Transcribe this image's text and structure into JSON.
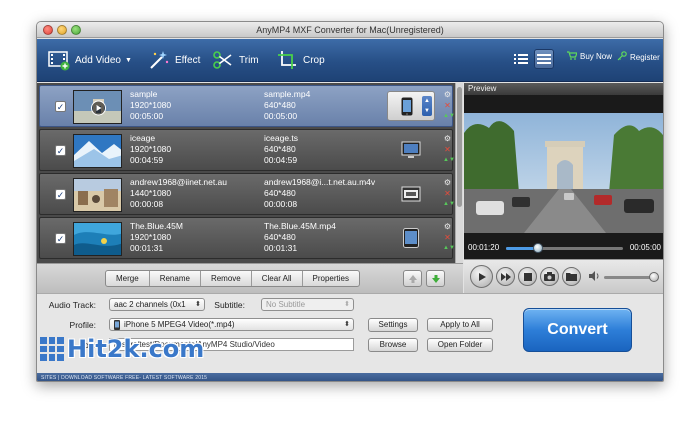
{
  "window": {
    "title": "AnyMP4 MXF Converter for Mac(Unregistered)"
  },
  "toolbar": {
    "add_video": "Add Video",
    "effect": "Effect",
    "trim": "Trim",
    "crop": "Crop",
    "buy_now": "Buy Now",
    "register": "Register",
    "active_view": "detail"
  },
  "files": [
    {
      "name": "sample",
      "resolution": "1920*1080",
      "duration": "00:05:00",
      "out_name": "sample.mp4",
      "out_resolution": "640*480",
      "out_duration": "00:05:00",
      "device": "phone-icon",
      "selected": true,
      "checked": true
    },
    {
      "name": "iceage",
      "resolution": "1920*1080",
      "duration": "00:04:59",
      "out_name": "iceage.ts",
      "out_resolution": "640*480",
      "out_duration": "00:04:59",
      "device": "hd-tv-icon",
      "selected": false,
      "checked": true
    },
    {
      "name": "andrew1968@iinet.net.au",
      "resolution": "1440*1080",
      "duration": "00:00:08",
      "out_name": "andrew1968@i...t.net.au.m4v",
      "out_resolution": "640*480",
      "out_duration": "00:00:08",
      "device": "video-file-icon",
      "selected": false,
      "checked": true
    },
    {
      "name": "The.Blue.45M",
      "resolution": "1920*1080",
      "duration": "00:01:31",
      "out_name": "The.Blue.45M.mp4",
      "out_resolution": "640*480",
      "out_duration": "00:01:31",
      "device": "tablet-icon",
      "selected": false,
      "checked": true
    }
  ],
  "preview": {
    "label": "Preview",
    "current_time": "00:01:20",
    "total_time": "00:05:00",
    "progress": 0.27,
    "volume": 1.0
  },
  "actions": {
    "merge": "Merge",
    "rename": "Rename",
    "remove": "Remove",
    "clear_all": "Clear All",
    "properties": "Properties"
  },
  "settings": {
    "audio_track_label": "Audio Track:",
    "audio_track_value": "aac 2 channels (0x1",
    "subtitle_label": "Subtitle:",
    "subtitle_value": "No Subtitle",
    "profile_label": "Profile:",
    "profile_value": "iPhone 5 MPEG4 Video(*.mp4)",
    "destination_label": "tion:",
    "destination_value": "/Users/test/Documents/AnyMP4 Studio/Video",
    "settings_btn": "Settings",
    "apply_all_btn": "Apply to All",
    "browse_btn": "Browse",
    "open_folder_btn": "Open Folder",
    "convert_btn": "Convert"
  },
  "status_text": "SITES | DOWNLOAD SOFTWARE FREE- LATEST SOFTWARE 2015",
  "watermark": "Hit2k.com",
  "colors": {
    "toolbar": "#274f86",
    "accent": "#2d7ed8",
    "selected_row": "#7a90b8"
  }
}
